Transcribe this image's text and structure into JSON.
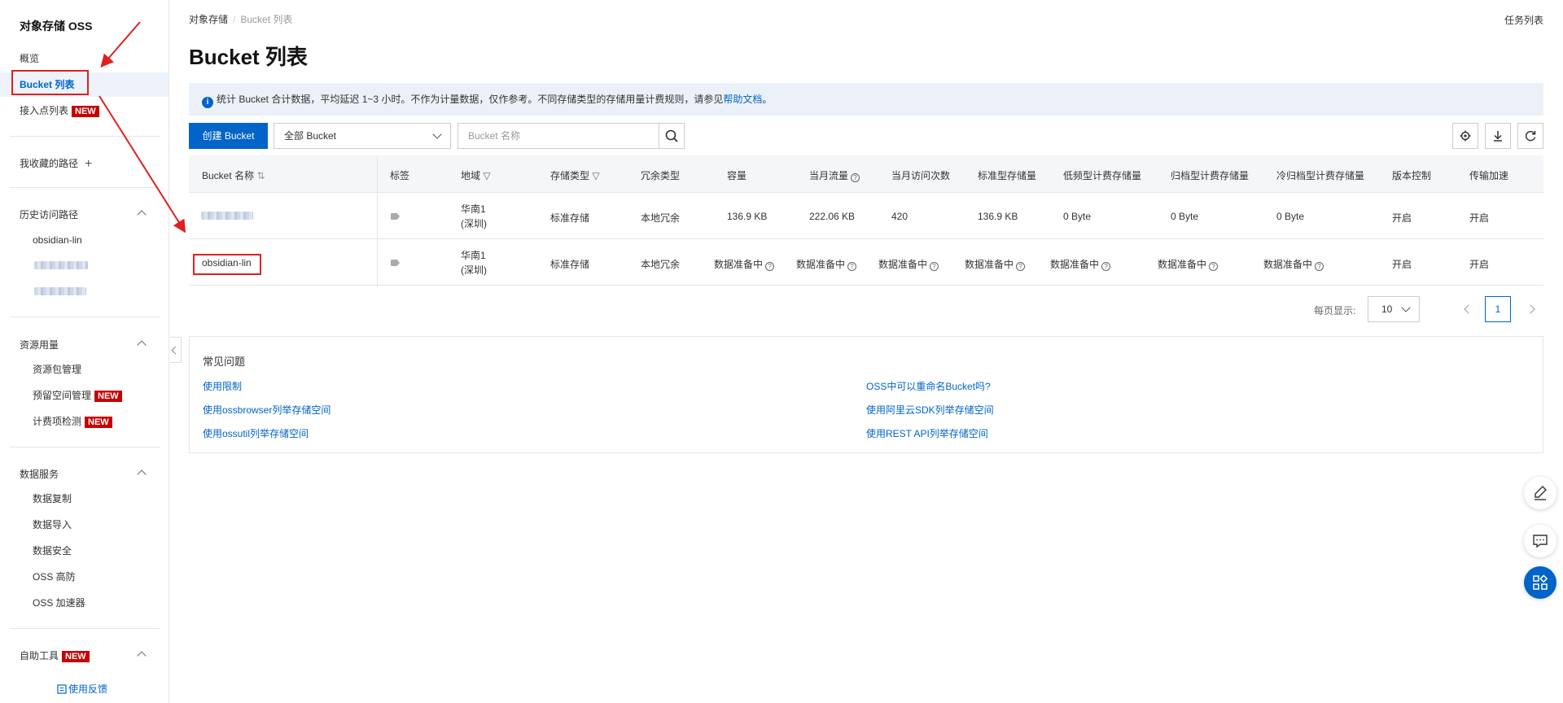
{
  "sidebar": {
    "title": "对象存储 OSS",
    "items": [
      {
        "label": "概览"
      },
      {
        "label": "Bucket 列表"
      },
      {
        "label": "接入点列表",
        "badge": "NEW"
      }
    ],
    "favorites": {
      "label": "我收藏的路径",
      "icon": "+"
    },
    "history": {
      "label": "历史访问路径",
      "items": [
        "obsidian-lin"
      ]
    },
    "resources": {
      "label": "资源用量",
      "items": [
        {
          "label": "资源包管理"
        },
        {
          "label": "预留空间管理",
          "badge": "NEW"
        },
        {
          "label": "计费项检测",
          "badge": "NEW"
        }
      ]
    },
    "data_services": {
      "label": "数据服务",
      "items": [
        {
          "label": "数据复制"
        },
        {
          "label": "数据导入"
        },
        {
          "label": "数据安全"
        },
        {
          "label": "OSS 高防"
        },
        {
          "label": "OSS 加速器"
        }
      ]
    },
    "tools": {
      "label": "自助工具",
      "badge": "NEW"
    },
    "feedback": "使用反馈"
  },
  "breadcrumb": {
    "root": "对象存储",
    "current": "Bucket 列表"
  },
  "task_list": "任务列表",
  "page_title": "Bucket 列表",
  "notice": {
    "text": "统计 Bucket 合计数据，平均延迟 1~3 小时。不作为计量数据，仅作参考。不同存储类型的存储用量计费规则，请参见",
    "link": "帮助文档",
    "end": "。"
  },
  "toolbar": {
    "create_label": "创建 Bucket",
    "filter_value": "全部 Bucket",
    "search_placeholder": "Bucket 名称"
  },
  "table": {
    "headers": [
      "Bucket 名称",
      "标签",
      "地域",
      "存储类型",
      "冗余类型",
      "容量",
      "当月流量",
      "当月访问次数",
      "标准型存储量",
      "低频型计费存储量",
      "归档型计费存储量",
      "冷归档型计费存储量",
      "版本控制",
      "传输加速"
    ],
    "rows": [
      {
        "region_1": "华南1",
        "region_2": "(深圳)",
        "storage": "标准存储",
        "redundancy": "本地冗余",
        "capacity": "136.9 KB",
        "traffic": "222.06 KB",
        "visits": "420",
        "std": "136.9 KB",
        "ia": "0 Byte",
        "archive": "0 Byte",
        "cold": "0 Byte",
        "versioning": "开启",
        "acceleration": "开启"
      },
      {
        "name": "obsidian-lin",
        "region_1": "华南1",
        "region_2": "(深圳)",
        "storage": "标准存储",
        "redundancy": "本地冗余",
        "capacity": "数据准备中",
        "traffic": "数据准备中",
        "visits": "数据准备中",
        "std": "数据准备中",
        "ia": "数据准备中",
        "archive": "数据准备中",
        "cold": "数据准备中",
        "versioning": "开启",
        "acceleration": "开启"
      }
    ]
  },
  "pager": {
    "label": "每页显示:",
    "size": "10",
    "page": "1"
  },
  "faq": {
    "title": "常见问题",
    "links": [
      "使用限制",
      "使用ossbrowser列举存储空间",
      "使用ossutil列举存储空间",
      "OSS中可以重命名Bucket吗?",
      "使用阿里云SDK列举存储空间",
      "使用REST API列举存储空间"
    ]
  },
  "colors": {
    "primary": "#0064c8",
    "badge": "#c80000",
    "annotation": "#e02020"
  }
}
